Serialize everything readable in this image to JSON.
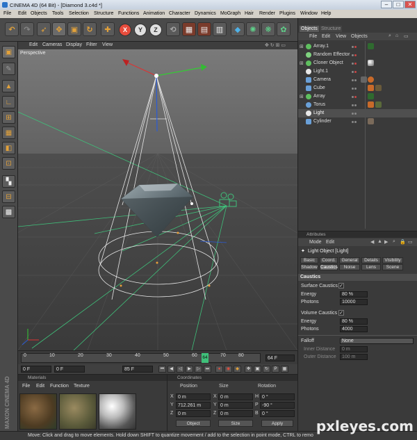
{
  "window": {
    "title": "CINEMA 4D (64 Bit) - [Diamond 3.c4d *]",
    "controls": {
      "minimize": "–",
      "maximize": "□",
      "close": "✕"
    }
  },
  "menubar": [
    "File",
    "Edit",
    "Objects",
    "Tools",
    "Selection",
    "Structure",
    "Functions",
    "Animation",
    "Character",
    "Dynamics",
    "MoGraph",
    "Hair",
    "Render",
    "Plugins",
    "Window",
    "Help"
  ],
  "toolbar": {
    "axis_labels": [
      "X",
      "Y",
      "Z"
    ]
  },
  "viewport": {
    "menu": [
      "Edit",
      "Cameras",
      "Display",
      "Filter",
      "View"
    ],
    "label": "Perspective"
  },
  "timeline": {
    "ticks": [
      "0",
      "10",
      "20",
      "30",
      "40",
      "50",
      "60",
      "70",
      "80"
    ],
    "current": "64",
    "end_field": "64 F",
    "start_field": "0 F",
    "min_field": "0 F",
    "max_field": "85 F"
  },
  "materials": {
    "header": "Materials",
    "menu": [
      "File",
      "Edit",
      "Function",
      "Texture"
    ]
  },
  "coordinates": {
    "header": "Coordinates",
    "columns": [
      "Position",
      "Size",
      "Rotation"
    ],
    "rows": [
      {
        "axis": "X",
        "pos": "0 m",
        "size_axis": "X",
        "size": "0 m",
        "rot_axis": "H",
        "rot": "0 °"
      },
      {
        "axis": "Y",
        "pos": "712.261 m",
        "size_axis": "Y",
        "size": "0 m",
        "rot_axis": "P",
        "rot": "-90 °"
      },
      {
        "axis": "Z",
        "pos": "0 m",
        "size_axis": "Z",
        "size": "0 m",
        "rot_axis": "B",
        "rot": "0 °"
      }
    ],
    "mode1": "Object",
    "mode2": "Size",
    "apply": "Apply"
  },
  "objects": {
    "tabs": [
      "Objects",
      "Structure"
    ],
    "menu": [
      "File",
      "Edit",
      "View",
      "Objects"
    ],
    "items": [
      {
        "name": "Array.1",
        "color": "#5fbf5f",
        "expand": "⊞",
        "indent": 0
      },
      {
        "name": "Random Effector",
        "color": "#7fd17f",
        "expand": "",
        "indent": 0
      },
      {
        "name": "Cloner Object",
        "color": "#5fbf5f",
        "expand": "⊞",
        "indent": 0
      },
      {
        "name": "Light.1",
        "color": "#e8e8e8",
        "expand": "",
        "indent": 0
      },
      {
        "name": "Camera",
        "color": "#6aa0d8",
        "expand": "",
        "indent": 0
      },
      {
        "name": "Cube",
        "color": "#6aa0d8",
        "expand": "",
        "indent": 0
      },
      {
        "name": "Array",
        "color": "#5fbf5f",
        "expand": "⊞",
        "indent": 0
      },
      {
        "name": "Torus",
        "color": "#6aa0d8",
        "expand": "",
        "indent": 0
      },
      {
        "name": "Light",
        "color": "#e8e8e8",
        "expand": "",
        "indent": 0
      },
      {
        "name": "Cylinder",
        "color": "#6aa0d8",
        "expand": "",
        "indent": 0
      }
    ]
  },
  "attributes": {
    "header": "Attributes",
    "menu": [
      "Mode",
      "Edit"
    ],
    "object_title": "Light Object [Light]",
    "tabs_row1": [
      "Basic",
      "Coord.",
      "General",
      "Details",
      "Visibility"
    ],
    "tabs_row2": [
      "Shadow",
      "Caustics",
      "Noise",
      "Lens",
      "Scene"
    ],
    "selected_tab": "Caustics",
    "section": "Caustics",
    "surface_caustics": "Surface Caustics",
    "energy_label": "Energy",
    "energy_value": "80 %",
    "photons_label": "Photons",
    "photons_value": "10000",
    "volume_caustics": "Volume Caustics",
    "vol_energy_value": "80 %",
    "vol_photons_value": "4000",
    "falloff_label": "Falloff",
    "falloff_value": "None",
    "inner_distance_label": "Inner Distance",
    "inner_distance_value": "0 m",
    "outer_distance_label": "Outer Distance",
    "outer_distance_value": "100 m"
  },
  "statusbar": "Move: Click and drag to move elements. Hold down SHIFT to quantize movement / add to the selection in point mode, CTRL to remo",
  "brand": "MAXON CINEMA 4D",
  "watermark": "pxleyes.com"
}
